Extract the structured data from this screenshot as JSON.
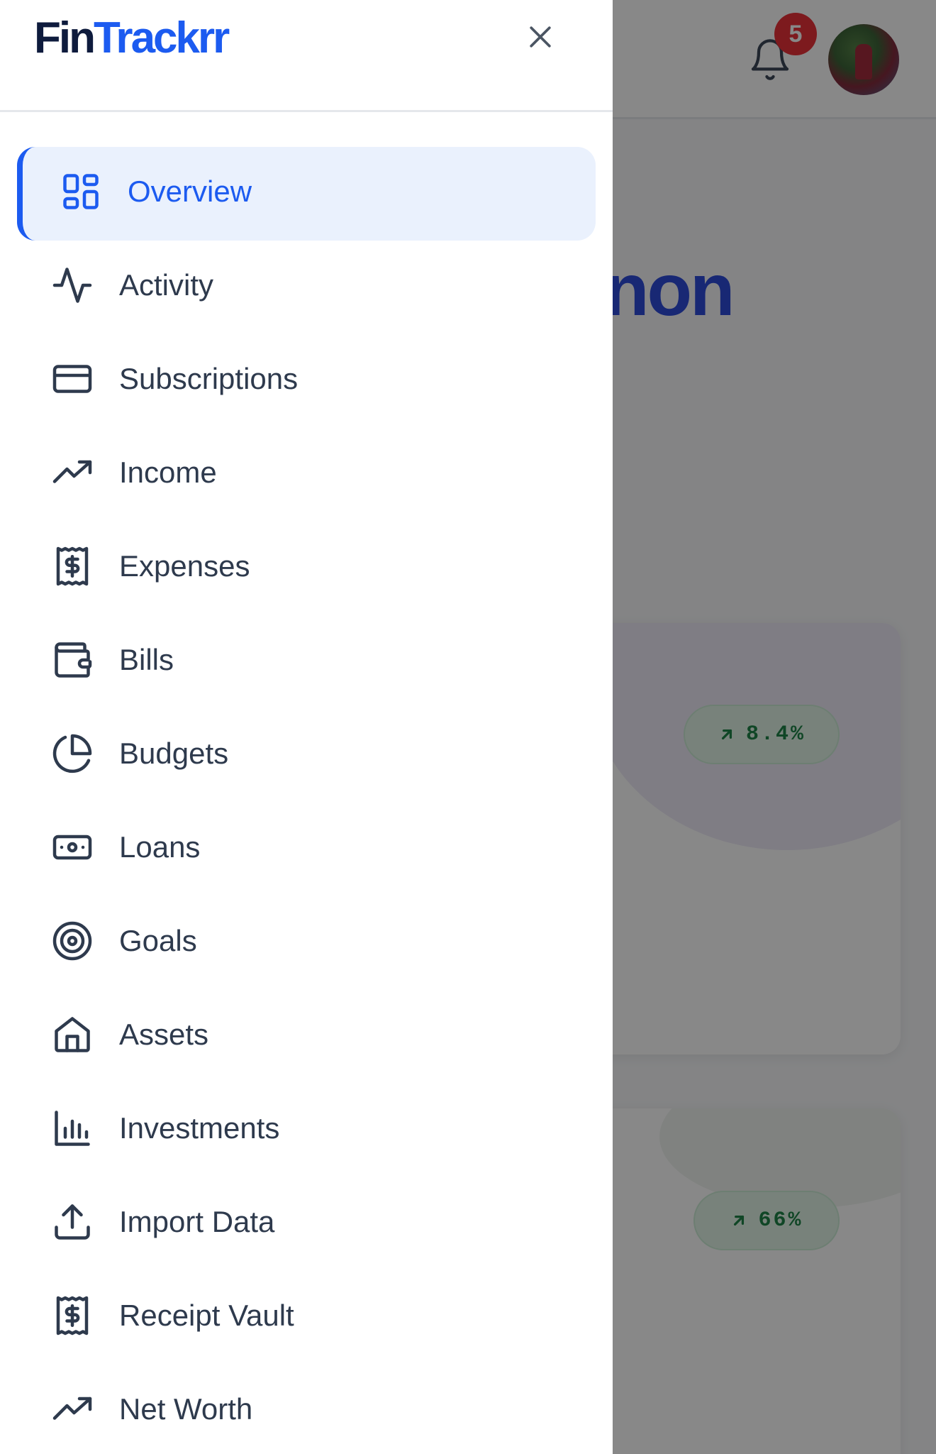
{
  "brand": {
    "part1": "Fin",
    "part2": "Trackrr"
  },
  "header": {
    "notification_count": "5"
  },
  "background": {
    "title_fragment": "non",
    "cards": [
      {
        "change": "8.4%"
      },
      {
        "change": "66%"
      }
    ]
  },
  "nav": {
    "items": [
      {
        "label": "Overview",
        "icon": "grid-icon",
        "active": true
      },
      {
        "label": "Activity",
        "icon": "activity-icon"
      },
      {
        "label": "Subscriptions",
        "icon": "credit-card-icon"
      },
      {
        "label": "Income",
        "icon": "trending-up-icon"
      },
      {
        "label": "Expenses",
        "icon": "receipt-icon"
      },
      {
        "label": "Bills",
        "icon": "wallet-icon"
      },
      {
        "label": "Budgets",
        "icon": "pie-chart-icon"
      },
      {
        "label": "Loans",
        "icon": "banknote-icon"
      },
      {
        "label": "Goals",
        "icon": "target-icon"
      },
      {
        "label": "Assets",
        "icon": "home-icon"
      },
      {
        "label": "Investments",
        "icon": "bar-chart-icon"
      },
      {
        "label": "Import Data",
        "icon": "upload-icon"
      },
      {
        "label": "Receipt Vault",
        "icon": "receipt-icon"
      },
      {
        "label": "Net Worth",
        "icon": "trending-up-icon"
      }
    ]
  },
  "colors": {
    "accent": "#1c5bf0",
    "active_bg": "#eaf1fd",
    "text": "#2e3a4d",
    "badge": "#e8222b",
    "positive": "#0f7a3a"
  }
}
